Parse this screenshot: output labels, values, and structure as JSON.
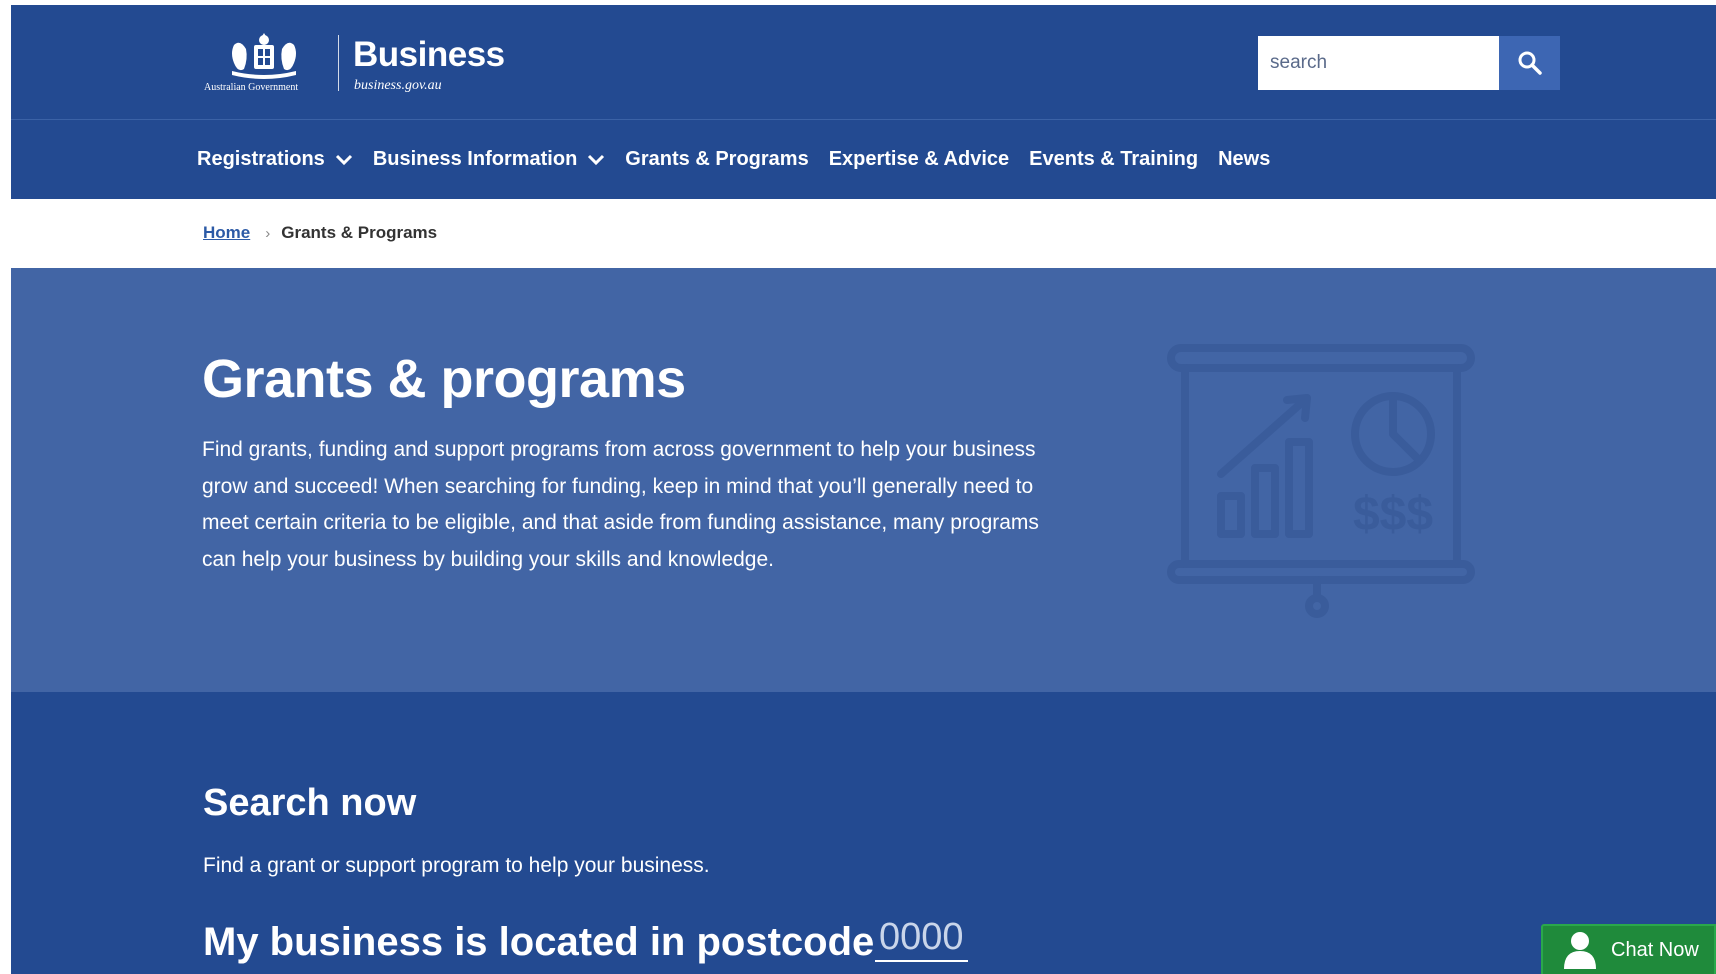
{
  "header": {
    "gov_label": "Australian Government",
    "brand": "Business",
    "brand_url": "business.gov.au",
    "search_placeholder": "search",
    "search_icon": "magnifier-icon"
  },
  "nav": {
    "items": [
      {
        "label": "Registrations",
        "has_dropdown": true
      },
      {
        "label": "Business Information",
        "has_dropdown": true
      },
      {
        "label": "Grants & Programs",
        "has_dropdown": false
      },
      {
        "label": "Expertise & Advice",
        "has_dropdown": false
      },
      {
        "label": "Events & Training",
        "has_dropdown": false
      },
      {
        "label": "News",
        "has_dropdown": false
      }
    ]
  },
  "breadcrumb": {
    "home": "Home",
    "separator": "›",
    "current": "Grants & Programs"
  },
  "hero": {
    "title": "Grants & programs",
    "text": "Find grants, funding and support programs from across government to help your business grow and succeed! When searching for funding, keep in mind that you’ll generally need to meet certain criteria to be eligible, and that aside from funding assistance, many programs can help your business by building your skills and knowledge.",
    "illustration": "presentation-board-icon",
    "illustration_text": "$$$"
  },
  "search_section": {
    "title": "Search now",
    "text": "Find a grant or support program to help your business.",
    "postcode_label": "My business is located in postcode",
    "postcode_placeholder": "0000"
  },
  "chat": {
    "label": "Chat Now",
    "icon": "person-icon"
  },
  "colors": {
    "header_bg": "#234a91",
    "hero_bg": "#4265a5",
    "search_button": "#3d66b3",
    "chat_bg": "#1f8a3b"
  }
}
